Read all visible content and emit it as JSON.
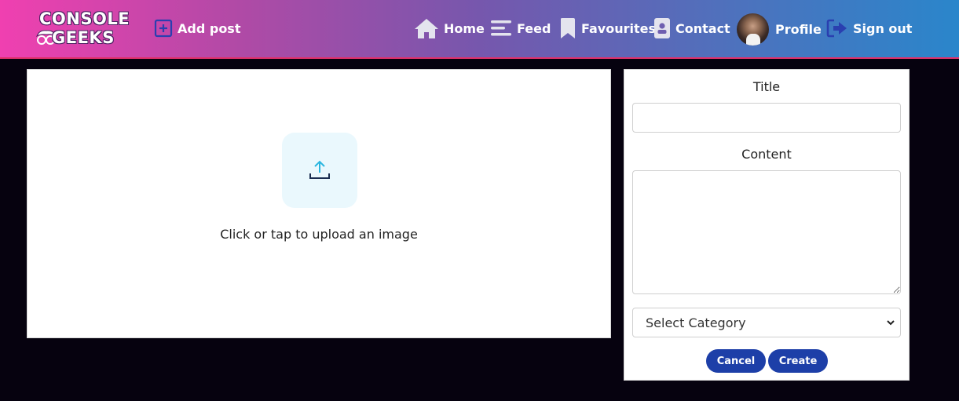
{
  "brand": {
    "line1": "CONSOLE",
    "line2": "GEEKS"
  },
  "nav": {
    "add_post": "Add post",
    "home": "Home",
    "feed": "Feed",
    "favourites": "Favourites",
    "contact": "Contact",
    "profile": "Profile",
    "sign_out": "Sign out"
  },
  "upload": {
    "prompt": "Click or tap to upload an image"
  },
  "form": {
    "title_label": "Title",
    "title_value": "",
    "content_label": "Content",
    "content_value": "",
    "category_selected": "Select Category",
    "cancel_label": "Cancel",
    "create_label": "Create"
  },
  "icons": {
    "add_post": "plus-square-icon",
    "home": "house-icon",
    "feed": "lines-icon",
    "favourites": "bookmark-icon",
    "contact": "contact-card-icon",
    "sign_out": "sign-out-icon",
    "upload": "upload-icon",
    "select": "chevron-down-icon"
  },
  "colors": {
    "header_gradient_start": "#f040b0",
    "header_gradient_end": "#2a86cb",
    "page_background": "#06020f",
    "icon_blue": "#2a3fb0",
    "button_blue": "#1d3fa8",
    "upload_tile": "#eaf8fd",
    "upload_arrow": "#2ab6e0"
  }
}
